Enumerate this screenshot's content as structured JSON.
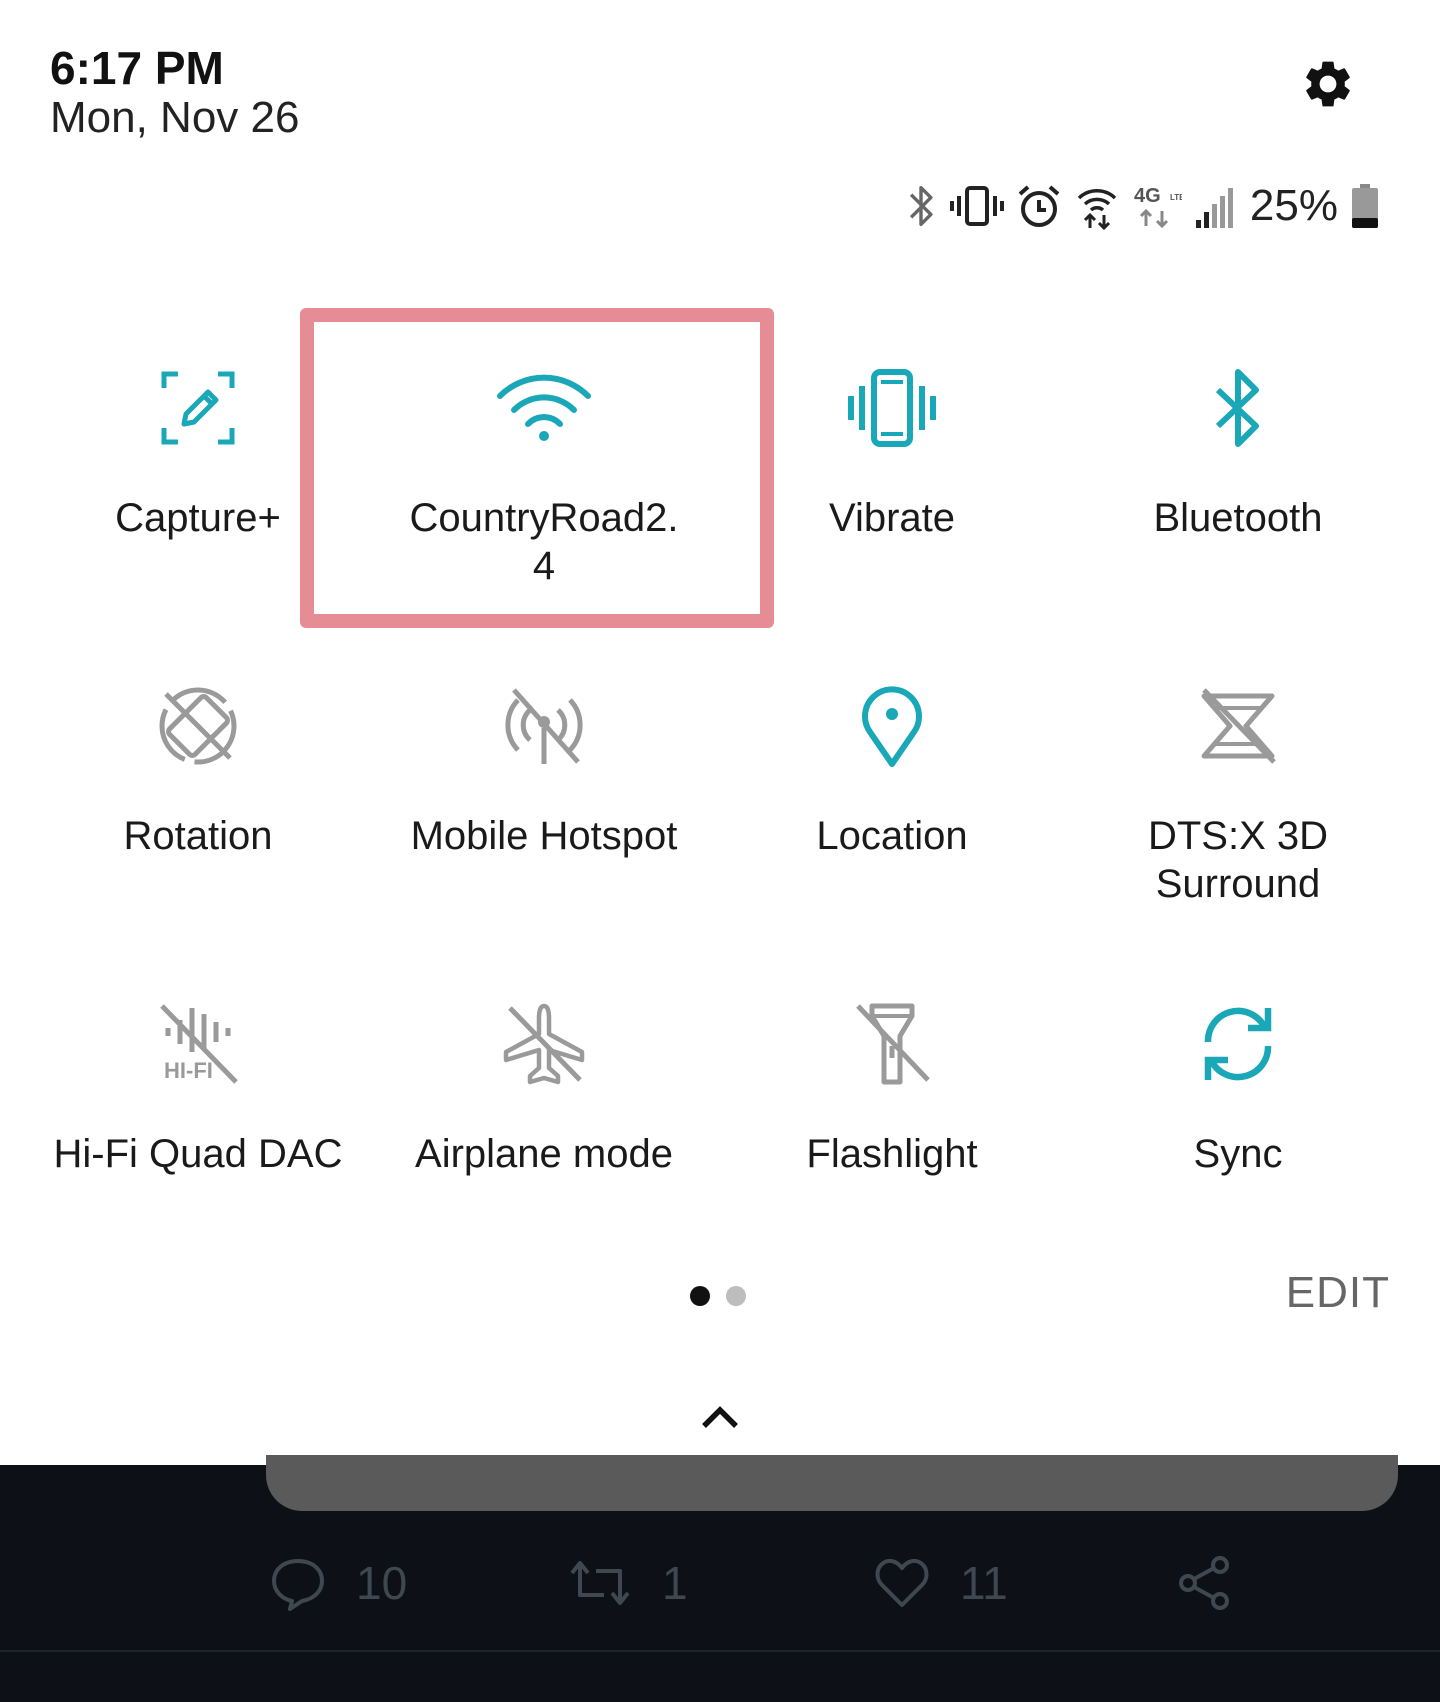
{
  "header": {
    "time": "6:17 PM",
    "date": "Mon, Nov 26",
    "settings_icon": "gear-icon"
  },
  "status_bar": {
    "icons": [
      "bluetooth-icon",
      "vibrate-icon",
      "alarm-icon",
      "wifi-data-icon",
      "4g-lte-icon",
      "signal-icon"
    ],
    "battery_percent": "25%",
    "battery_icon": "battery-icon"
  },
  "accent_color": "#1aa8b8",
  "inactive_color": "#9a9a9a",
  "highlight_color": "#e58c95",
  "tiles": [
    {
      "label": "Capture+",
      "icon": "capture-plus-icon",
      "active": true
    },
    {
      "label": "CountryRoad2.\n4",
      "icon": "wifi-icon",
      "active": true
    },
    {
      "label": "Vibrate",
      "icon": "vibrate-icon",
      "active": true
    },
    {
      "label": "Bluetooth",
      "icon": "bluetooth-icon",
      "active": true
    },
    {
      "label": "Rotation",
      "icon": "rotation-off-icon",
      "active": false
    },
    {
      "label": "Mobile Hotspot",
      "icon": "hotspot-off-icon",
      "active": false
    },
    {
      "label": "Location",
      "icon": "location-icon",
      "active": true
    },
    {
      "label": "DTS:X 3D Surround",
      "icon": "dtsx-off-icon",
      "active": false
    },
    {
      "label": "Hi-Fi Quad DAC",
      "icon": "hifi-off-icon",
      "active": false
    },
    {
      "label": "Airplane mode",
      "icon": "airplane-off-icon",
      "active": false
    },
    {
      "label": "Flashlight",
      "icon": "flashlight-off-icon",
      "active": false
    },
    {
      "label": "Sync",
      "icon": "sync-icon",
      "active": true
    }
  ],
  "pager": {
    "pages": 2,
    "current": 1
  },
  "edit_label": "EDIT",
  "collapse_icon": "chevron-up-icon",
  "background_app": {
    "replies": "10",
    "retweets": "1",
    "likes": "11"
  }
}
